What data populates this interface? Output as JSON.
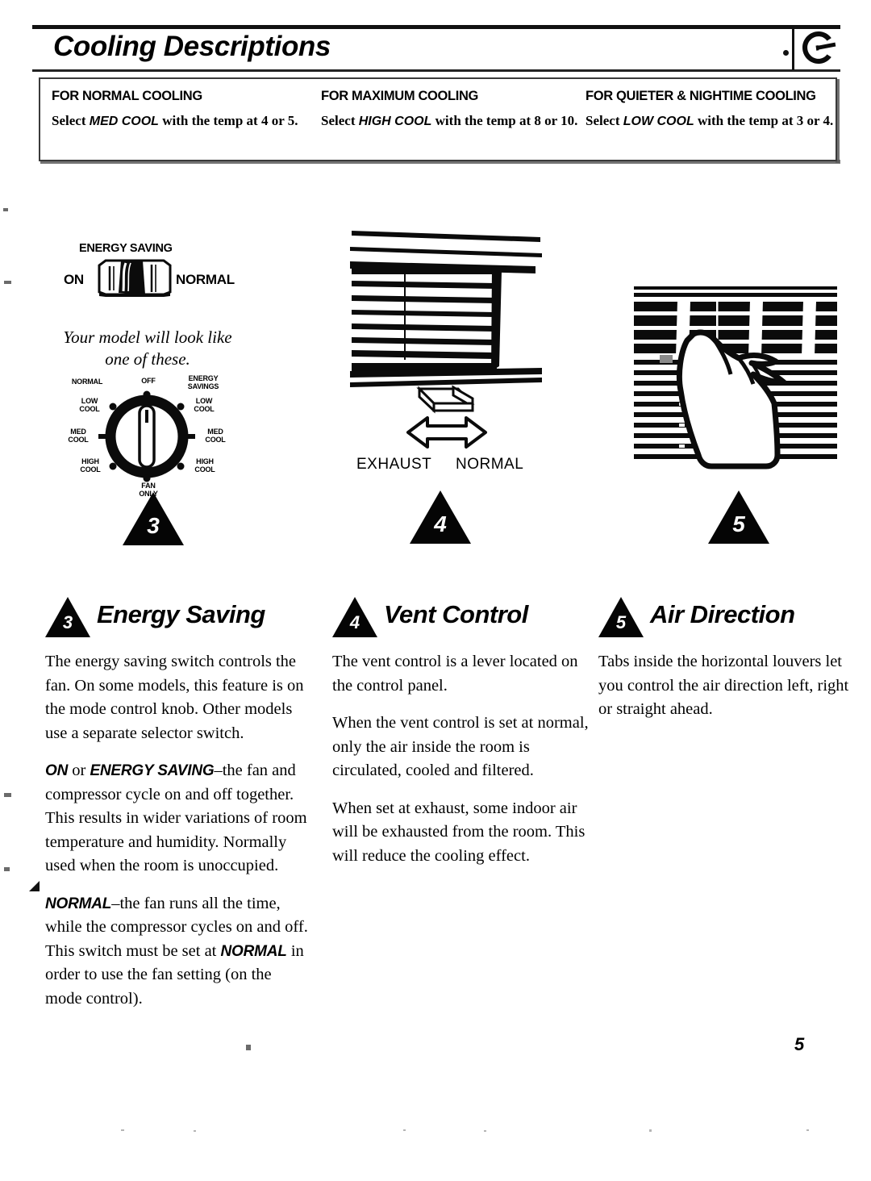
{
  "header": {
    "title": "Cooling Descriptions",
    "logo": "ge-monogram-logo"
  },
  "callout": {
    "columns": [
      {
        "heading": "FOR NORMAL COOLING",
        "lead": "Select ",
        "emphasis": "MED COOL",
        "tail": " with the temp at 4 or 5."
      },
      {
        "heading": "FOR MAXIMUM COOLING",
        "lead": "Select ",
        "emphasis": "HIGH COOL",
        "tail": " with the temp at 8 or 10."
      },
      {
        "heading": "FOR QUIETER & NIGHTIME COOLING",
        "lead": "Select ",
        "emphasis": "LOW COOL",
        "tail": " with the temp at 3 or 4."
      }
    ]
  },
  "figures": {
    "energy_saving": {
      "title": "ENERGY SAVING",
      "left_label": "ON",
      "right_label": "NORMAL",
      "note": "Your model will look like one of these.",
      "knob_labels": {
        "top": "OFF",
        "top_left": "NORMAL",
        "top_right": "ENERGY\nSAVINGS",
        "left_low": "LOW\nCOOL",
        "left_med": "MED\nCOOL",
        "left_high": "HIGH\nCOOL",
        "right_low": "LOW\nCOOL",
        "right_med": "MED\nCOOL",
        "right_high": "HIGH\nCOOL",
        "bottom": "FAN\nONLY"
      },
      "step_number": "3"
    },
    "vent_control": {
      "left_label": "EXHAUST",
      "right_label": "NORMAL",
      "step_number": "4"
    },
    "air_direction": {
      "step_number": "5"
    }
  },
  "sections": [
    {
      "number": "3",
      "title": "Energy Saving",
      "paragraphs": [
        {
          "runs": [
            {
              "t": "The energy saving switch controls the fan. On some models, this feature is on the mode control knob. Other models use a separate selector switch.",
              "b": false
            }
          ]
        },
        {
          "runs": [
            {
              "t": "ON",
              "b": true
            },
            {
              "t": " or ",
              "b": false
            },
            {
              "t": "ENERGY SAVING",
              "b": true
            },
            {
              "t": "–the fan and compressor cycle on and off together. This results in wider variations of room temperature and humidity. Normally used when the room is unoccupied.",
              "b": false
            }
          ]
        },
        {
          "runs": [
            {
              "t": "NORMAL",
              "b": true
            },
            {
              "t": "–the fan runs all the time, while the compressor cycles on and off. This switch must be set at ",
              "b": false
            },
            {
              "t": "NORMAL",
              "b": true
            },
            {
              "t": " in order to use the fan setting (on the mode control).",
              "b": false
            }
          ]
        }
      ]
    },
    {
      "number": "4",
      "title": "Vent Control",
      "paragraphs": [
        {
          "runs": [
            {
              "t": "The vent control is a lever located on the control panel.",
              "b": false
            }
          ]
        },
        {
          "runs": [
            {
              "t": "When the vent control is set at normal, only the air inside the room is circulated, cooled and filtered.",
              "b": false
            }
          ]
        },
        {
          "runs": [
            {
              "t": "When set at exhaust, some indoor air will be exhausted from the room. This will reduce the cooling effect.",
              "b": false
            }
          ]
        }
      ]
    },
    {
      "number": "5",
      "title": "Air Direction",
      "paragraphs": [
        {
          "runs": [
            {
              "t": "Tabs inside the horizontal louvers let you control the air direction left, right or straight ahead.",
              "b": false
            }
          ]
        }
      ]
    }
  ],
  "footer": {
    "page_number": "5"
  }
}
